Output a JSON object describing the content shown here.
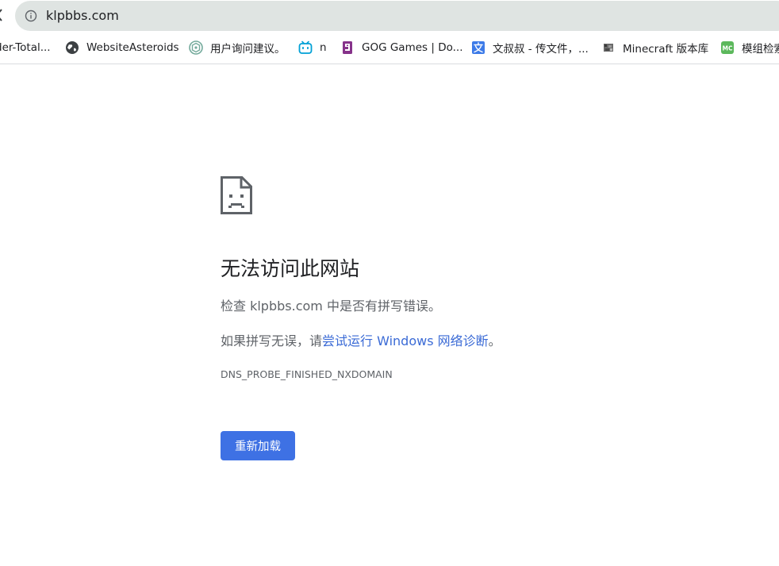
{
  "browser": {
    "url": "klpbbs.com",
    "bookmarks": [
      {
        "label": "der-Total...",
        "icon": "none"
      },
      {
        "label": "WebsiteAsteroids",
        "icon": "globe-icon"
      },
      {
        "label": "用户询问建议。",
        "icon": "openai-icon"
      },
      {
        "label": "n",
        "icon": "bilibili-icon"
      },
      {
        "label": "GOG Games | Do...",
        "icon": "gog-icon"
      },
      {
        "label": "文叔叔 - 传文件，...",
        "icon": "wenshushu-icon"
      },
      {
        "label": "Minecraft 版本库",
        "icon": "minecraft-icon"
      },
      {
        "label": "模组检索",
        "icon": "mc-mod-icon"
      }
    ]
  },
  "error_page": {
    "title": "无法访问此网站",
    "suggestion_1": "检查 klpbbs.com 中是否有拼写错误。",
    "suggestion_2_prefix": "如果拼写无误，请",
    "suggestion_2_link": "尝试运行 Windows 网络诊断",
    "suggestion_2_suffix": "。",
    "error_code": "DNS_PROBE_FINISHED_NXDOMAIN",
    "reload_label": "重新加载"
  },
  "colors": {
    "accent": "#3e71e4",
    "link": "#3b6bd6",
    "omnibox_bg": "#dfe4e2"
  }
}
